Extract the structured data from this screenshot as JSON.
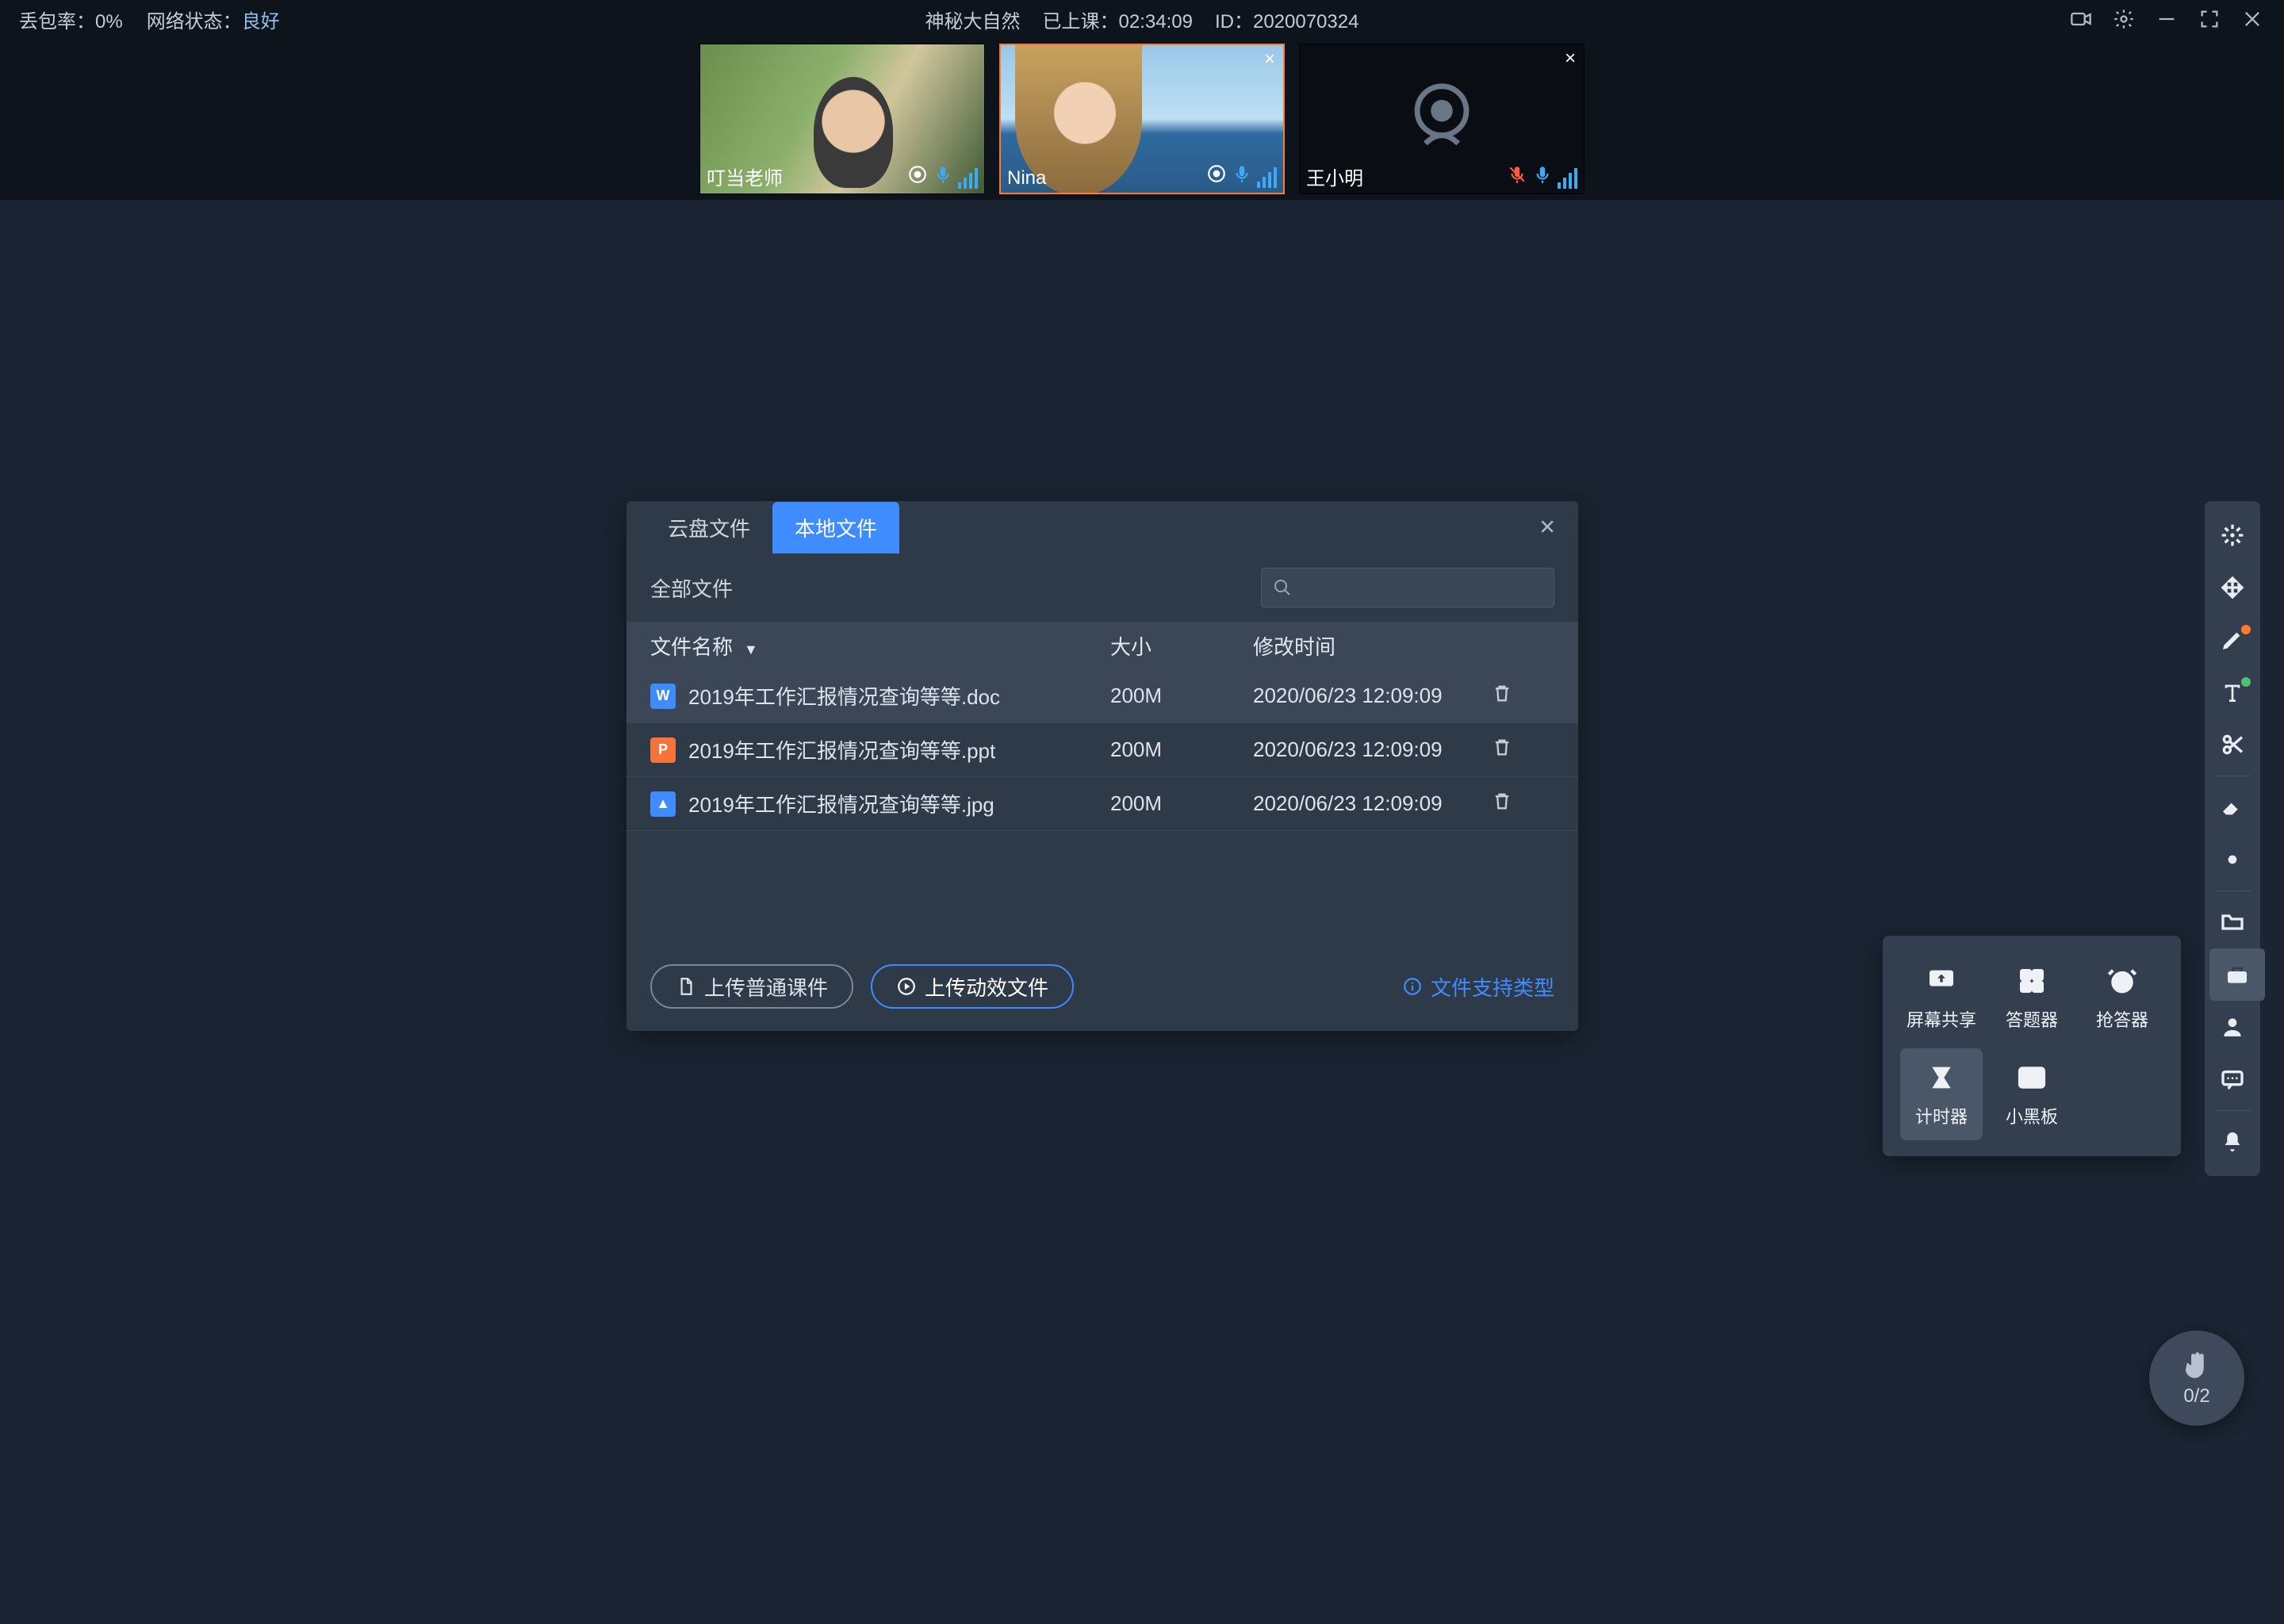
{
  "topbar": {
    "packet_loss_label": "丢包率：",
    "packet_loss_value": "0%",
    "net_label": "网络状态：",
    "net_value": "良好",
    "title": "神秘大自然",
    "elapsed_label": "已上课：",
    "elapsed_value": "02:34:09",
    "id_label": "ID：",
    "id_value": "2020070324"
  },
  "participants": [
    {
      "name": "叮当老师"
    },
    {
      "name": "Nina"
    },
    {
      "name": "王小明"
    }
  ],
  "file_dialog": {
    "tabs": {
      "cloud": "云盘文件",
      "local": "本地文件"
    },
    "breadcrumb": "全部文件",
    "headers": {
      "name": "文件名称",
      "size": "大小",
      "mtime": "修改时间"
    },
    "rows": [
      {
        "badge": "W",
        "cls": "doc",
        "name": "2019年工作汇报情况查询等等.doc",
        "size": "200M",
        "mtime": "2020/06/23 12:09:09"
      },
      {
        "badge": "P",
        "cls": "ppt",
        "name": "2019年工作汇报情况查询等等.ppt",
        "size": "200M",
        "mtime": "2020/06/23 12:09:09"
      },
      {
        "badge": "▲",
        "cls": "img",
        "name": "2019年工作汇报情况查询等等.jpg",
        "size": "200M",
        "mtime": "2020/06/23 12:09:09"
      }
    ],
    "upload_normal": "上传普通课件",
    "upload_anim": "上传动效文件",
    "supported_link": "文件支持类型"
  },
  "tool_popup": {
    "items": [
      {
        "label": "屏幕共享",
        "icon": "screen"
      },
      {
        "label": "答题器",
        "icon": "quiz"
      },
      {
        "label": "抢答器",
        "icon": "alarm"
      },
      {
        "label": "计时器",
        "icon": "timer",
        "selected": true
      },
      {
        "label": "小黑板",
        "icon": "board"
      }
    ]
  },
  "hand": {
    "count": "0/2"
  }
}
